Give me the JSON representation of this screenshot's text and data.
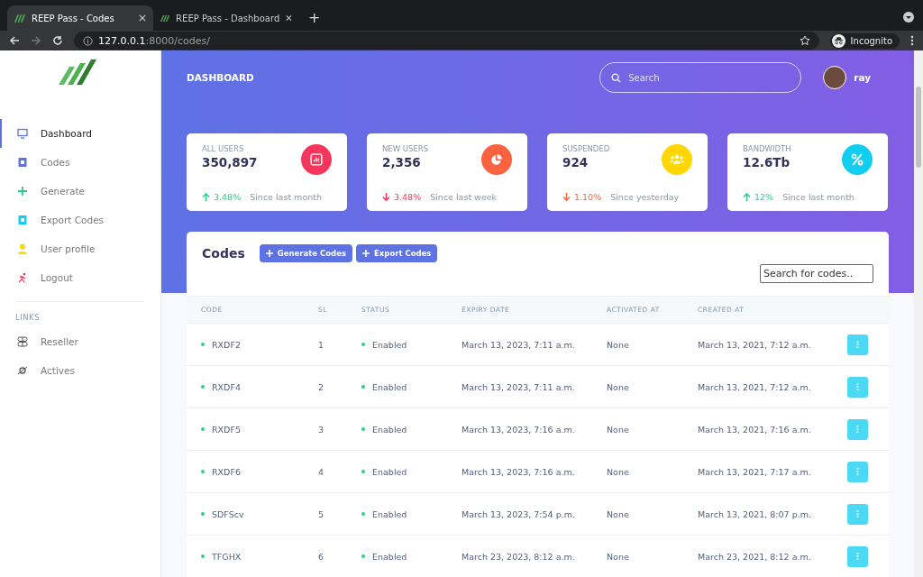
{
  "browser": {
    "tabs": [
      {
        "title": "REEP Pass - Codes",
        "selected": true
      },
      {
        "title": "REEP Pass - Dashboard",
        "selected": false
      }
    ],
    "new_tab": "+",
    "url_host": "127.0.0.1",
    "url_path": ":8000/codes/",
    "profile": "Incognito"
  },
  "sidebar": {
    "items": [
      {
        "label": "Dashboard",
        "selected": true,
        "color": "#5e72e4"
      },
      {
        "label": "Codes",
        "selected": false,
        "color": "#5e72e4"
      },
      {
        "label": "Generate",
        "selected": false,
        "color": "#2dce89"
      },
      {
        "label": "Export Codes",
        "selected": false,
        "color": "#11cdef"
      },
      {
        "label": "User profile",
        "selected": false,
        "color": "#ffd600"
      },
      {
        "label": "Logout",
        "selected": false,
        "color": "#f5365c"
      }
    ],
    "links_heading": "LINKS",
    "links": [
      {
        "label": "Reseller",
        "selected": false
      },
      {
        "label": "Actives",
        "selected": false
      }
    ]
  },
  "header": {
    "title": "DASHBOARD",
    "search": {
      "placeholder": "Search"
    },
    "user": "ray"
  },
  "stats": [
    {
      "label": "ALL USERS",
      "value": "350,897",
      "color": "#f5365c",
      "change": {
        "text": "3.48%",
        "rising": true,
        "color": "#2dce89"
      },
      "period": "Since last month"
    },
    {
      "label": "NEW USERS",
      "value": "2,356",
      "color": "#fb6340",
      "change": {
        "text": "3.48%",
        "rising": false,
        "color": "#f5365c"
      },
      "period": "Since last week"
    },
    {
      "label": "SUSPENDED",
      "value": "924",
      "color": "#ffd600",
      "change": {
        "text": "1.10%",
        "rising": false,
        "color": "#fb6340"
      },
      "period": "Since yesterday"
    },
    {
      "label": "BANDWIDTH",
      "value": "12.6Tb",
      "color": "#11cdef",
      "change": {
        "text": "12%",
        "rising": true,
        "color": "#2dce89"
      },
      "period": "Since last month"
    }
  ],
  "codes": {
    "title": "Codes",
    "buttons": [
      "Generate Codes",
      "Export Codes"
    ],
    "search": {
      "placeholder": "Search for codes.."
    },
    "columns": [
      "CODE",
      "SL",
      "STATUS",
      "EXPIRY DATE",
      "ACTIVATED AT",
      "CREATED AT"
    ],
    "rows": [
      {
        "code": "RXDF2",
        "sl": "1",
        "status": "Enabled",
        "expiry": "March 13, 2023, 7:11 a.m.",
        "activated": "None",
        "created": "March 13, 2021, 7:12 a.m."
      },
      {
        "code": "RXDF4",
        "sl": "2",
        "status": "Enabled",
        "expiry": "March 13, 2023, 7:11 a.m.",
        "activated": "None",
        "created": "March 13, 2021, 7:12 a.m."
      },
      {
        "code": "RXDF5",
        "sl": "3",
        "status": "Enabled",
        "expiry": "March 13, 2023, 7:16 a.m.",
        "activated": "None",
        "created": "March 13, 2021, 7:16 a.m."
      },
      {
        "code": "RXDF6",
        "sl": "4",
        "status": "Enabled",
        "expiry": "March 13, 2023, 7:16 a.m.",
        "activated": "None",
        "created": "March 13, 2021, 7:17 a.m."
      },
      {
        "code": "SDFScv",
        "sl": "5",
        "status": "Enabled",
        "expiry": "March 13, 2023, 7:54 p.m.",
        "activated": "None",
        "created": "March 13, 2021, 8:07 p.m."
      },
      {
        "code": "TFGHX",
        "sl": "6",
        "status": "Enabled",
        "expiry": "March 23, 2023, 8:12 a.m.",
        "activated": "None",
        "created": "March 23, 2021, 8:12 a.m."
      }
    ]
  }
}
